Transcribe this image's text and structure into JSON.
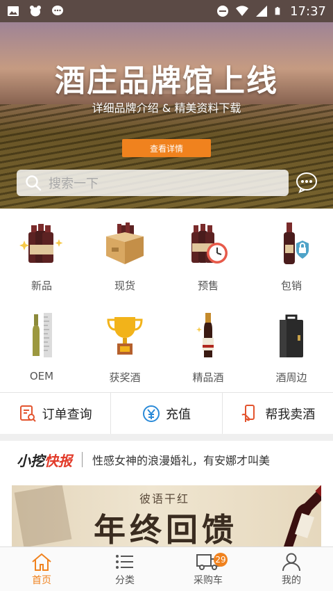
{
  "status_bar": {
    "time": "17:37"
  },
  "hero": {
    "title": "酒庄品牌馆上线",
    "subtitle": "详细品牌介绍 & 精美资料下载",
    "button_label": "查看详情"
  },
  "search": {
    "placeholder": "搜索一下"
  },
  "categories": [
    {
      "label": "新品",
      "icon": "new-wine-icon"
    },
    {
      "label": "现货",
      "icon": "wine-box-icon"
    },
    {
      "label": "预售",
      "icon": "presale-clock-icon"
    },
    {
      "label": "包销",
      "icon": "lock-bottle-icon"
    },
    {
      "label": "OEM",
      "icon": "oem-bottle-icon"
    },
    {
      "label": "获奖酒",
      "icon": "trophy-icon"
    },
    {
      "label": "精品酒",
      "icon": "premium-bottle-icon"
    },
    {
      "label": "酒周边",
      "icon": "wine-case-icon"
    }
  ],
  "quick_actions": [
    {
      "label": "订单查询",
      "icon": "order-search-icon"
    },
    {
      "label": "充值",
      "icon": "yen-icon"
    },
    {
      "label": "帮我卖酒",
      "icon": "hand-sell-icon"
    }
  ],
  "news": {
    "brand_part1": "小挖",
    "brand_part2": "快报",
    "text": "性感女神的浪漫婚礼，有安娜才叫美"
  },
  "banner": {
    "small_text": "彼语干红",
    "big_text": "年终回馈"
  },
  "tabbar": {
    "items": [
      {
        "label": "首页",
        "icon": "home-icon",
        "active": true
      },
      {
        "label": "分类",
        "icon": "list-icon",
        "active": false
      },
      {
        "label": "采购车",
        "icon": "truck-icon",
        "active": false,
        "badge": "29"
      },
      {
        "label": "我的",
        "icon": "user-icon",
        "active": false
      }
    ]
  },
  "colors": {
    "accent": "#f0821e",
    "news_highlight": "#e23b2a"
  }
}
